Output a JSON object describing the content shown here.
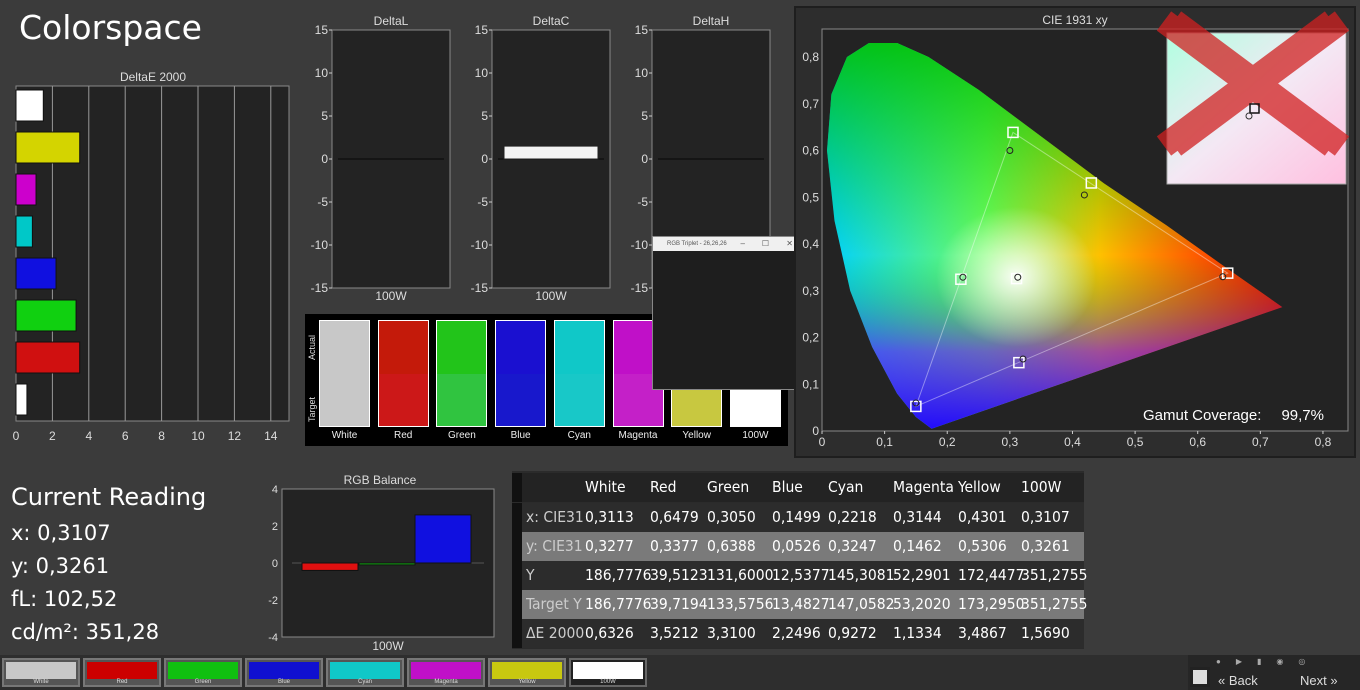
{
  "header": {
    "title": "Colorspace"
  },
  "deltae": {
    "title": "DeltaE 2000",
    "xticks": [
      "0",
      "2",
      "4",
      "6",
      "8",
      "10",
      "12",
      "14"
    ],
    "bars": [
      {
        "name": "White",
        "value": 1.5,
        "color": "#ffffff"
      },
      {
        "name": "Yellow",
        "value": 3.5,
        "color": "#d4d400"
      },
      {
        "name": "Magenta",
        "value": 1.1,
        "color": "#cc00cc"
      },
      {
        "name": "Cyan",
        "value": 0.9,
        "color": "#00c8c8"
      },
      {
        "name": "Blue",
        "value": 2.2,
        "color": "#1010e0"
      },
      {
        "name": "Green",
        "value": 3.3,
        "color": "#10d010"
      },
      {
        "name": "Red",
        "value": 3.5,
        "color": "#d01010"
      },
      {
        "name": "100W",
        "value": 0.6,
        "color": "#ffffff"
      }
    ]
  },
  "delta_charts": [
    {
      "title": "DeltaL",
      "xlabel": "100W",
      "value": 0
    },
    {
      "title": "DeltaC",
      "xlabel": "100W",
      "value": 1.5
    },
    {
      "title": "DeltaH",
      "xlabel": "100W",
      "value": 0
    }
  ],
  "delta_yticks": [
    "15",
    "10",
    "5",
    "0",
    "-5",
    "-10",
    "-15"
  ],
  "patches": {
    "actual_label": "Actual",
    "target_label": "Target",
    "items": [
      {
        "name": "White",
        "actual": "#c8c8c8",
        "target": "#c8c8c8"
      },
      {
        "name": "Red",
        "actual": "#c41a0a",
        "target": "#cc1818"
      },
      {
        "name": "Green",
        "actual": "#22c41a",
        "target": "#30c440"
      },
      {
        "name": "Blue",
        "actual": "#1a10d0",
        "target": "#1818cc"
      },
      {
        "name": "Cyan",
        "actual": "#10c8c8",
        "target": "#18c8c8"
      },
      {
        "name": "Magenta",
        "actual": "#c010c8",
        "target": "#c420c8"
      },
      {
        "name": "Yellow",
        "actual": "#c8c840",
        "target": "#c8c840"
      },
      {
        "name": "100W",
        "actual": "#ffffff",
        "target": "#ffffff"
      }
    ]
  },
  "popup": {
    "title": "RGB Triplet - 26,26,26"
  },
  "cie": {
    "title": "CIE 1931 xy",
    "gamut_label": "Gamut Coverage:",
    "gamut_value": "99,7%",
    "xticks": [
      "0",
      "0,1",
      "0,2",
      "0,3",
      "0,4",
      "0,5",
      "0,6",
      "0,7",
      "0,8"
    ],
    "yticks": [
      "0",
      "0,1",
      "0,2",
      "0,3",
      "0,4",
      "0,5",
      "0,6",
      "0,7",
      "0,8"
    ]
  },
  "current": {
    "title": "Current Reading",
    "x": "x: 0,3107",
    "y": "y: 0,3261",
    "fl": "fL: 102,52",
    "cd": "cd/m²: 351,28"
  },
  "rgb_balance": {
    "title": "RGB Balance",
    "xlabel": "100W",
    "yticks": [
      "4",
      "2",
      "0",
      "-2",
      "-4"
    ],
    "bars": [
      {
        "name": "Red",
        "value": -0.4,
        "color": "#e01010"
      },
      {
        "name": "Green",
        "value": -0.1,
        "color": "#10c010"
      },
      {
        "name": "Blue",
        "value": 2.6,
        "color": "#1010e0"
      }
    ]
  },
  "table": {
    "headers": [
      "",
      "White",
      "Red",
      "Green",
      "Blue",
      "Cyan",
      "Magenta",
      "Yellow",
      "100W"
    ],
    "rows": [
      [
        "x: CIE31",
        "0,3113",
        "0,6479",
        "0,3050",
        "0,1499",
        "0,2218",
        "0,3144",
        "0,4301",
        "0,3107"
      ],
      [
        "y: CIE31",
        "0,3277",
        "0,3377",
        "0,6388",
        "0,0526",
        "0,3247",
        "0,1462",
        "0,5306",
        "0,3261"
      ],
      [
        "Y",
        "186,7776",
        "39,5123",
        "131,6000",
        "12,5377",
        "145,3081",
        "52,2901",
        "172,4477",
        "351,2755"
      ],
      [
        "Target Y",
        "186,7776",
        "39,7194",
        "133,5756",
        "13,4827",
        "147,0582",
        "53,2020",
        "173,2950",
        "351,2755"
      ],
      [
        "ΔE 2000",
        "0,6326",
        "3,5212",
        "3,3100",
        "2,2496",
        "0,9272",
        "1,1334",
        "3,4867",
        "1,5690"
      ]
    ]
  },
  "swatches": [
    {
      "label": "White",
      "color": "#c8c8c8"
    },
    {
      "label": "Red",
      "color": "#cc0000"
    },
    {
      "label": "Green",
      "color": "#10c010"
    },
    {
      "label": "Blue",
      "color": "#1010d0"
    },
    {
      "label": "Cyan",
      "color": "#10c8c8"
    },
    {
      "label": "Magenta",
      "color": "#c010c8"
    },
    {
      "label": "Yellow",
      "color": "#c8c810"
    },
    {
      "label": "100W",
      "color": "#ffffff"
    }
  ],
  "nav": {
    "back": "Back",
    "next": "Next"
  }
}
